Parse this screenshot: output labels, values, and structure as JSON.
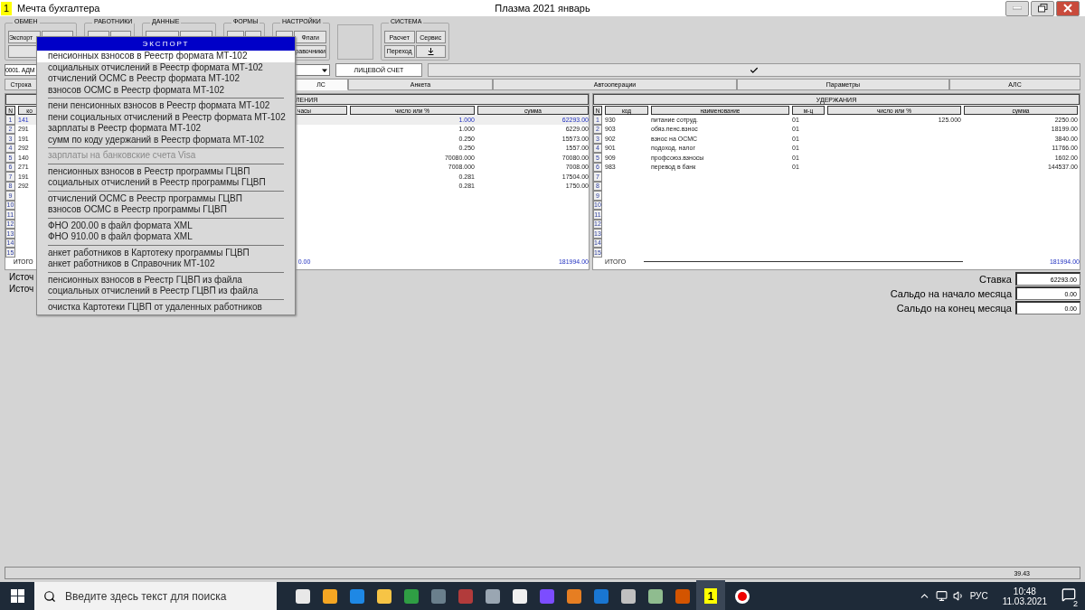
{
  "window": {
    "app_badge": "1",
    "title": "Мечта бухгалтера",
    "document_title": "Плазма 2021 январь"
  },
  "toolbar": {
    "group_titles": [
      "ОБМЕН",
      "РАБОТНИКИ",
      "ДАННЫЕ",
      "ФОРМЫ",
      "НАСТРОЙКИ",
      "СИСТЕМА"
    ],
    "exchange_button": "Экспорт",
    "settings_buttons": [
      "Флаги",
      "равочники"
    ],
    "system_buttons": [
      "Расчет",
      "Сервис",
      "Переход"
    ]
  },
  "account": {
    "value": "0001. АДМ",
    "tab": "ЛИЦЕВОЙ СЧЕТ"
  },
  "row_button": "Строка",
  "tabs": [
    {
      "label": "ЛС",
      "selected": true
    },
    {
      "label": "Анкета",
      "selected": false
    },
    {
      "label": "Автооперации",
      "selected": false
    },
    {
      "label": "Параметры",
      "selected": false
    },
    {
      "label": "АЛС",
      "selected": false
    }
  ],
  "accruals": {
    "title": "ЛЕНИЯ",
    "columns": [
      "N",
      "ко",
      "часы",
      "число или %",
      "сумма"
    ],
    "rows": [
      {
        "n": "1",
        "code": "141",
        "number": "1.000",
        "sum": "62293.00",
        "selected": true
      },
      {
        "n": "2",
        "code": "291",
        "number": "1.000",
        "sum": "6229.00",
        "selected": false
      },
      {
        "n": "3",
        "code": "191",
        "number": "0.250",
        "sum": "15573.00",
        "selected": false
      },
      {
        "n": "4",
        "code": "292",
        "number": "0.250",
        "sum": "1557.00",
        "selected": false
      },
      {
        "n": "5",
        "code": "140",
        "number": "70080.000",
        "sum": "70080.00",
        "selected": false
      },
      {
        "n": "6",
        "code": "271",
        "number": "7008.000",
        "sum": "7008.00",
        "selected": false
      },
      {
        "n": "7",
        "code": "191",
        "number": "0.281",
        "sum": "17504.00",
        "selected": false
      },
      {
        "n": "8",
        "code": "292",
        "number": "0.281",
        "sum": "1750.00",
        "selected": false
      },
      {
        "n": "9",
        "selected": false
      },
      {
        "n": "10",
        "selected": false
      },
      {
        "n": "11",
        "selected": false
      },
      {
        "n": "12",
        "selected": false
      },
      {
        "n": "13",
        "selected": false
      },
      {
        "n": "14",
        "selected": false
      },
      {
        "n": "15",
        "selected": false
      }
    ],
    "total_label": "ИТОГО",
    "total_hours": "0.00",
    "total_sum": "181994.00"
  },
  "deductions": {
    "title": "УДЕРЖАНИЯ",
    "columns": [
      "N",
      "код",
      "наименование",
      "м-ц",
      "число или %",
      "сумма"
    ],
    "rows": [
      {
        "n": "1",
        "code": "930",
        "name": "питание сотруд.",
        "month": "01",
        "number": "125.000",
        "sum": "2250.00"
      },
      {
        "n": "2",
        "code": "903",
        "name": "обяз.пенс.взнос",
        "month": "01",
        "sum": "18199.00"
      },
      {
        "n": "3",
        "code": "902",
        "name": "взнос на ОСМС",
        "month": "01",
        "sum": "3840.00"
      },
      {
        "n": "4",
        "code": "901",
        "name": "подоход. налог",
        "month": "01",
        "sum": "11766.00"
      },
      {
        "n": "5",
        "code": "909",
        "name": "профсоюз.взносы",
        "month": "01",
        "sum": "1602.00"
      },
      {
        "n": "6",
        "code": "983",
        "name": "перевод в банк",
        "month": "01",
        "sum": "144537.00"
      },
      {
        "n": "7"
      },
      {
        "n": "8"
      },
      {
        "n": "9"
      },
      {
        "n": "10"
      },
      {
        "n": "11"
      },
      {
        "n": "12"
      },
      {
        "n": "13"
      },
      {
        "n": "14"
      },
      {
        "n": "15"
      }
    ],
    "total_label": "ИТОГО",
    "total_sum": "181994.00"
  },
  "sources": [
    "Источ",
    "Источ"
  ],
  "balances": [
    {
      "label": "Ставка",
      "value": "62293.00"
    },
    {
      "label": "Сальдо на начало месяца",
      "value": "0.00"
    },
    {
      "label": "Сальдо на конец месяца",
      "value": "0.00"
    }
  ],
  "status_bar": {
    "value": "39.43"
  },
  "export_menu": {
    "title": "ЭКСПОРТ",
    "groups": [
      {
        "items": [
          {
            "label": "пенсионных взносов в Реестр формата МТ-102",
            "selected": true,
            "disabled": false
          },
          {
            "label": "социальных отчислений в Реестр формата МТ-102",
            "selected": false,
            "disabled": false
          },
          {
            "label": "отчислений ОСМС в Реестр формата МТ-102",
            "selected": false,
            "disabled": false
          },
          {
            "label": "взносов ОСМС в Реестр формата МТ-102",
            "selected": false,
            "disabled": false
          }
        ]
      },
      {
        "items": [
          {
            "label": "пени пенсионных взносов в Реестр формата МТ-102",
            "selected": false,
            "disabled": false
          },
          {
            "label": "пени социальных отчислений в Реестр формата МТ-102",
            "selected": false,
            "disabled": false
          },
          {
            "label": "зарплаты в Реестр формата МТ-102",
            "selected": false,
            "disabled": false
          },
          {
            "label": "сумм по коду удержаний в Реестр формата МТ-102",
            "selected": false,
            "disabled": false
          }
        ]
      },
      {
        "items": [
          {
            "label": "зарплаты на банковские счета Visa",
            "selected": false,
            "disabled": true
          }
        ]
      },
      {
        "items": [
          {
            "label": "пенсионных взносов в Реестр программы ГЦВП",
            "selected": false,
            "disabled": false
          },
          {
            "label": "социальных отчислений в Реестр программы ГЦВП",
            "selected": false,
            "disabled": false
          }
        ]
      },
      {
        "items": [
          {
            "label": "отчислений ОСМС в Реестр программы ГЦВП",
            "selected": false,
            "disabled": false
          },
          {
            "label": "взносов ОСМС в Реестр программы ГЦВП",
            "selected": false,
            "disabled": false
          }
        ]
      },
      {
        "items": [
          {
            "label": "ФНО 200.00 в файл формата XML",
            "selected": false,
            "disabled": false
          },
          {
            "label": "ФНО 910.00 в файл формата XML",
            "selected": false,
            "disabled": false
          }
        ]
      },
      {
        "items": [
          {
            "label": "анкет работников в Картотеку программы ГЦВП",
            "selected": false,
            "disabled": false
          },
          {
            "label": "анкет работников в Справочник МТ-102",
            "selected": false,
            "disabled": false
          }
        ]
      },
      {
        "items": [
          {
            "label": "пенсионных взносов в Реестр ГЦВП из файла",
            "selected": false,
            "disabled": false
          },
          {
            "label": "социальных отчислений в Реестр ГЦВП из файла",
            "selected": false,
            "disabled": false
          }
        ]
      },
      {
        "items": [
          {
            "label": "очистка Картотеки ГЦВП от удаленных работников",
            "selected": false,
            "disabled": false
          }
        ]
      }
    ]
  },
  "taskbar": {
    "search": {
      "placeholder": "Введите здесь текст для поиска"
    },
    "app_label": "1",
    "language": "РУС",
    "time": "10:48",
    "date": "11.03.2021",
    "notifications": "2"
  }
}
